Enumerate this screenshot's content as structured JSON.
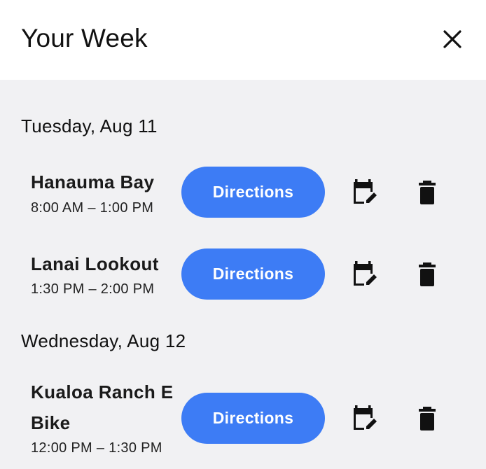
{
  "header": {
    "title": "Your Week",
    "close_icon": "close-icon"
  },
  "colors": {
    "primary_button": "#3d7cf5",
    "background": "#f1f1f3",
    "header_background": "#ffffff"
  },
  "days": [
    {
      "heading": "Tuesday, Aug 11",
      "events": [
        {
          "name": "Hanauma Bay",
          "time": "8:00 AM – 1:00 PM",
          "directions_label": "Directions",
          "edit_icon": "calendar-edit-icon",
          "delete_icon": "trash-icon"
        },
        {
          "name": "Lanai Lookout",
          "time": "1:30 PM – 2:00 PM",
          "directions_label": "Directions",
          "edit_icon": "calendar-edit-icon",
          "delete_icon": "trash-icon"
        }
      ]
    },
    {
      "heading": "Wednesday, Aug 12",
      "events": [
        {
          "name": "Kualoa Ranch E Bike",
          "time": "12:00 PM – 1:30 PM",
          "directions_label": "Directions",
          "edit_icon": "calendar-edit-icon",
          "delete_icon": "trash-icon"
        }
      ]
    }
  ]
}
